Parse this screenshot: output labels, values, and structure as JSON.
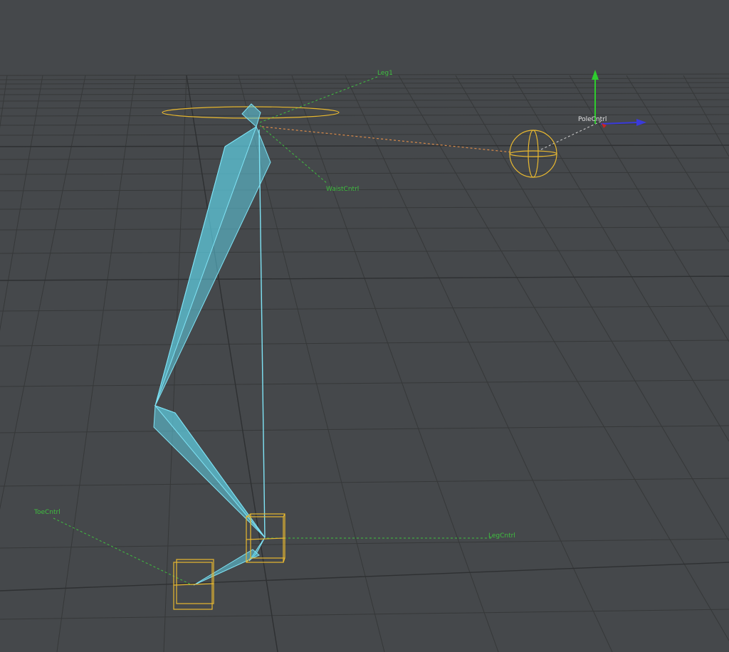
{
  "viewport": {
    "background": "#45484b",
    "grid_color": "#37393c",
    "bone_color": "#5fd0e6",
    "control_color": "#e8b830",
    "link_color": "#3fbf3f"
  },
  "labels": {
    "leg1": "Leg1",
    "waist_cntrl": "WaistCntrl",
    "pole_cntrl": "PoleCntrl",
    "toe_cntrl": "ToeCntrl",
    "leg_cntrl": "LegCntrl"
  },
  "gizmo": {
    "y_axis_color": "#2ecc2e",
    "x_axis_color": "#3a3adb",
    "z_axis_color": "#cc2222"
  }
}
